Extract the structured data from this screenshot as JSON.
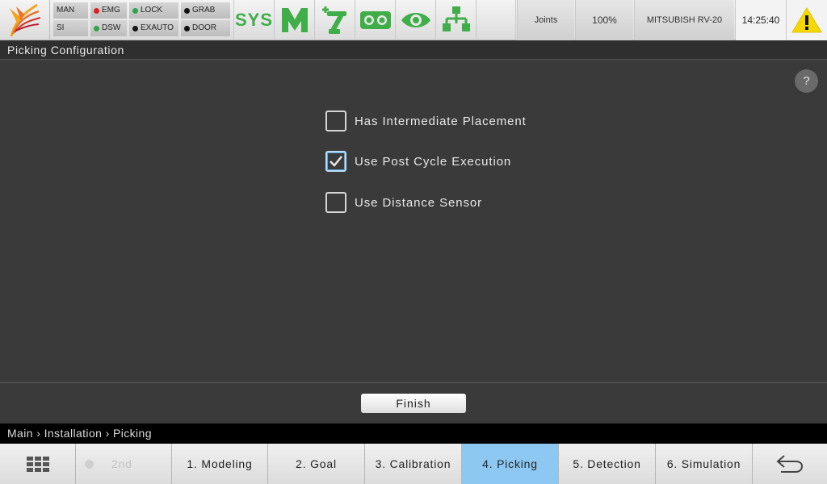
{
  "status": {
    "mode": {
      "top": "MAN",
      "bottom": "SI"
    },
    "emg": "EMG",
    "dsw": "DSW",
    "lock": "LOCK",
    "exauto": "EXAUTO",
    "grab": "GRAB",
    "door": "DOOR",
    "colors": {
      "emg": "#e02020",
      "dsw": "#2fa54a",
      "lock": "#2fa54a",
      "exauto": "#111111",
      "grab": "#111111",
      "door": "#111111"
    }
  },
  "toolbar": {
    "sys_label": "SYS",
    "icons": [
      "m-logo-icon",
      "robot-arm-icon",
      "camera-icon",
      "eye-icon",
      "network-icon"
    ],
    "accent": "#3fae49",
    "joints_label": "Joints",
    "speed_label": "100%",
    "robot_label": "MITSUBISH RV-20",
    "time": "14:25:40",
    "warning_icon": "warning-icon"
  },
  "title": "Picking Configuration",
  "help_label": "?",
  "options": [
    {
      "label": "Has Intermediate Placement",
      "checked": false
    },
    {
      "label": "Use Post Cycle Execution",
      "checked": true
    },
    {
      "label": "Use Distance Sensor",
      "checked": false
    }
  ],
  "finish_label": "Finish",
  "breadcrumb": "Main › Installation › Picking",
  "nav": {
    "menu_icon": "grid-icon",
    "second": "2nd",
    "steps": [
      "1. Modeling",
      "2. Goal",
      "3. Calibration",
      "4. Picking",
      "5. Detection",
      "6. Simulation"
    ],
    "active_index": 3,
    "back_icon": "back-arrow-icon",
    "active_color": "#8cc8f2"
  }
}
